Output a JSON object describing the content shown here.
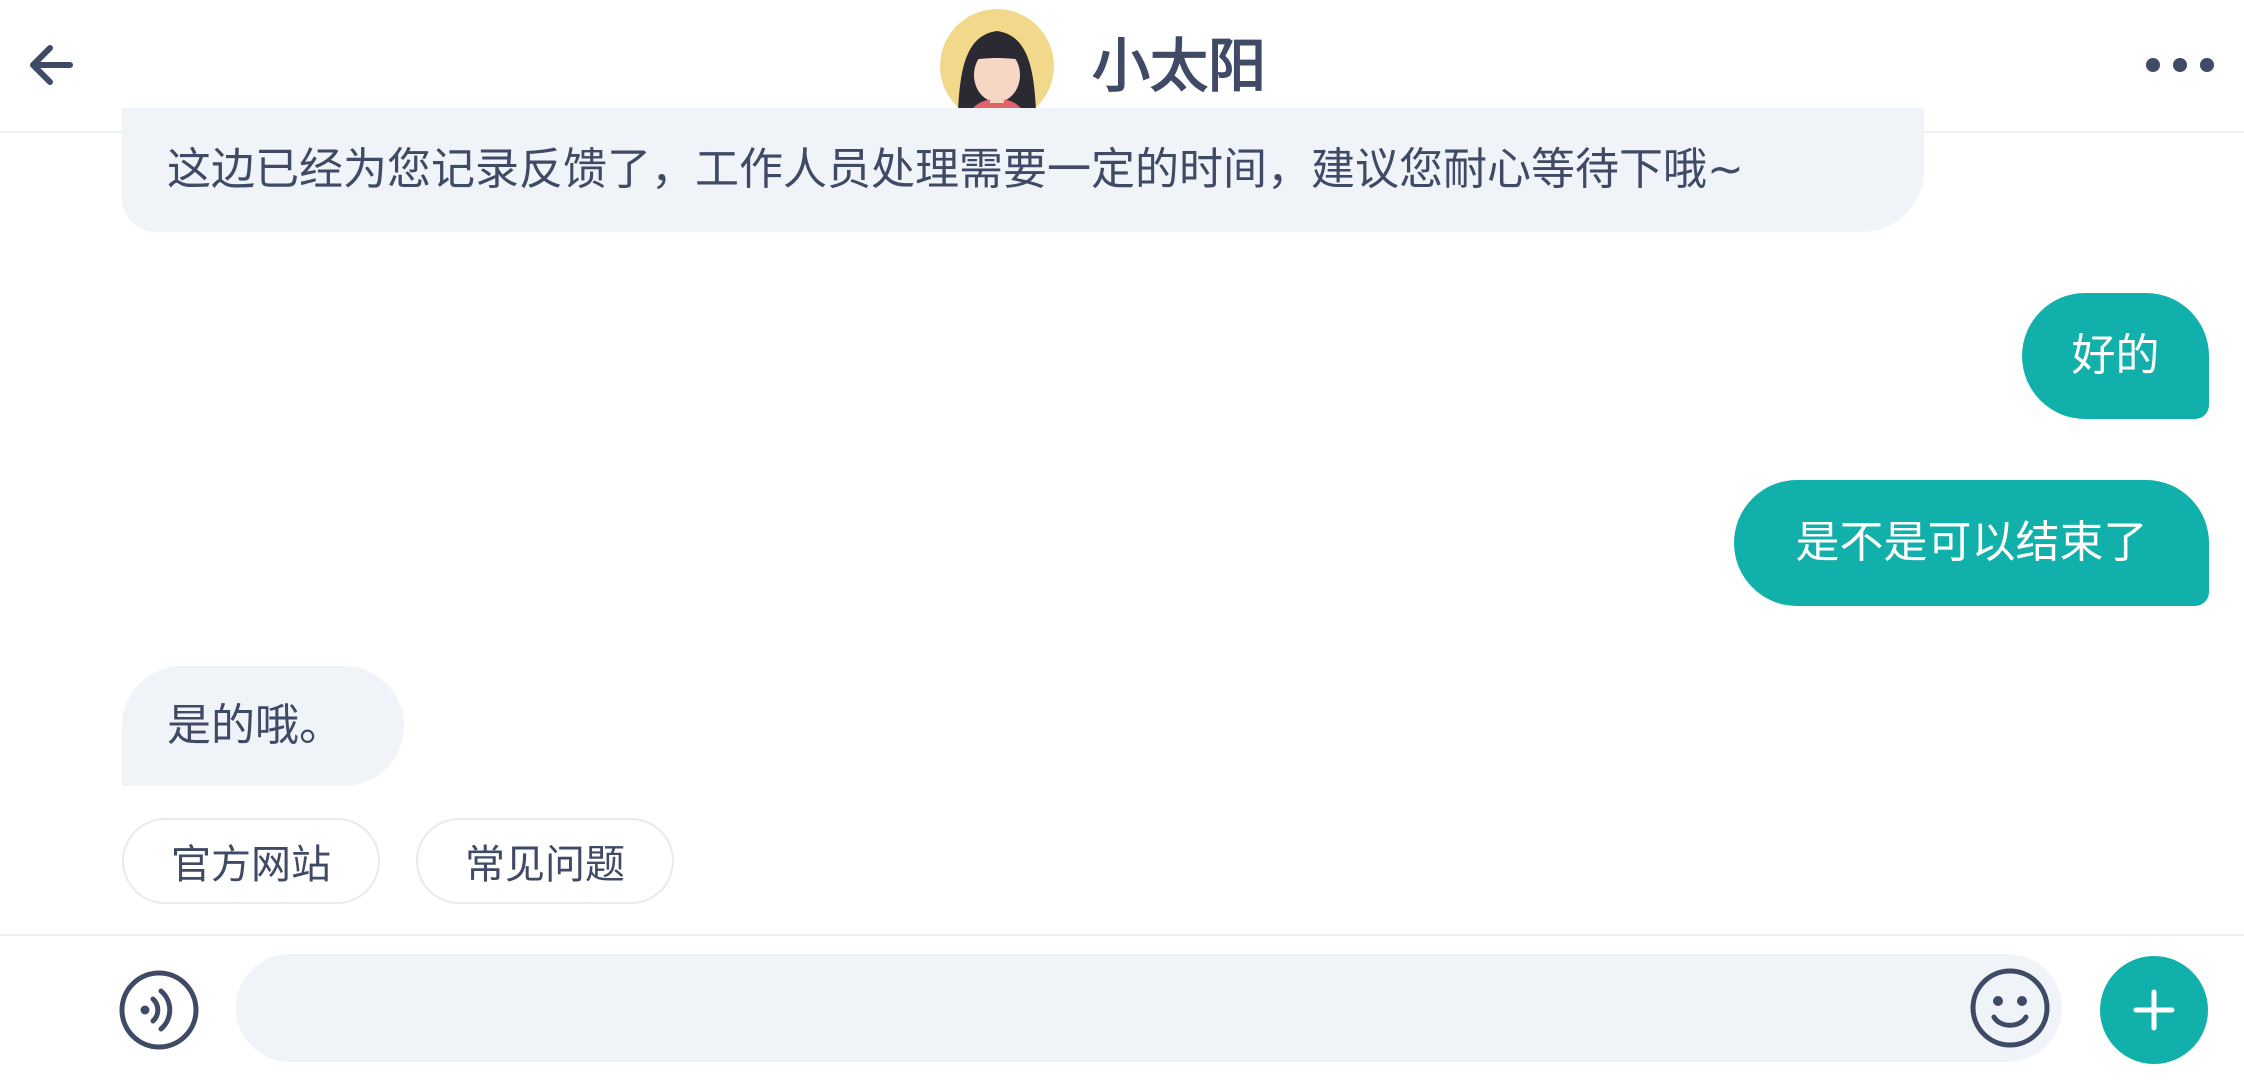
{
  "header": {
    "title": "小太阳",
    "back_icon": "arrow-left-icon",
    "more_icon": "more-horizontal-icon",
    "avatar_icon": "girl-avatar"
  },
  "messages": [
    {
      "from": "agent",
      "text": "这边已经为您记录反馈了，工作人员处理需要一定的时间，建议您耐心等待下哦~"
    },
    {
      "from": "user",
      "text": "好的"
    },
    {
      "from": "user",
      "text": "是不是可以结束了"
    },
    {
      "from": "agent",
      "text": "是的哦。"
    }
  ],
  "quick_replies": [
    "官方网站",
    "常见问题"
  ],
  "input": {
    "value": "",
    "placeholder": ""
  },
  "toolbar": {
    "voice_icon": "voice-icon",
    "emoji_icon": "emoji-icon",
    "plus_icon": "plus-icon"
  },
  "colors": {
    "accent": "#12b0ab",
    "agent_bubble": "#f0f3f8",
    "text": "#3f4a66"
  }
}
